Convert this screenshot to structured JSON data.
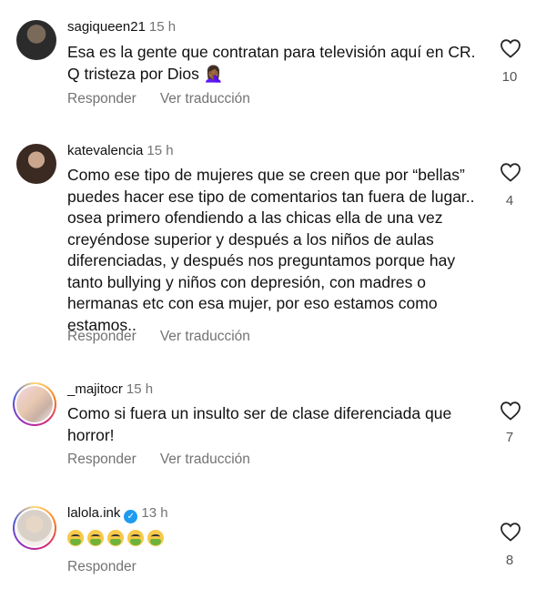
{
  "comments": [
    {
      "username": "sagiqueen21",
      "time": "15 h",
      "text": "Esa es la gente que contratan para televisión aquí en CR. Q tristeza por Dios 🤦🏾‍♀️",
      "reply": "Responder",
      "translate": "Ver traducción",
      "likes": "10",
      "avatar_color": "#2b2b2b"
    },
    {
      "username": "katevalencia",
      "time": "15 h",
      "text": "Como ese tipo de mujeres que se creen que por “bellas” puedes hacer ese tipo de comentarios tan fuera de lugar.. osea primero ofendiendo a las chicas ella de una vez creyéndose superior y después a los niños de aulas diferenciadas, y después nos preguntamos porque hay tanto bullying y niños con depresión, con madres o hermanas etc con esa mujer, por eso estamos como estamos..",
      "reply": "Responder",
      "translate": "Ver traducción",
      "likes": "4",
      "avatar_color": "#6b4a3a"
    },
    {
      "username": "_majitocr",
      "time": "15 h",
      "text": "Como si fuera un insulto ser de clase diferenciada que horror!",
      "reply": "Responder",
      "translate": "Ver traducción",
      "likes": "7",
      "avatar_color": "#d9c9c0"
    },
    {
      "username": "lalola.ink",
      "time": "13 h",
      "emoji_count": 5,
      "emoji_name": "nauseated-face",
      "reply": "Responder",
      "likes": "8",
      "avatar_color": "#e8e0d8"
    }
  ]
}
